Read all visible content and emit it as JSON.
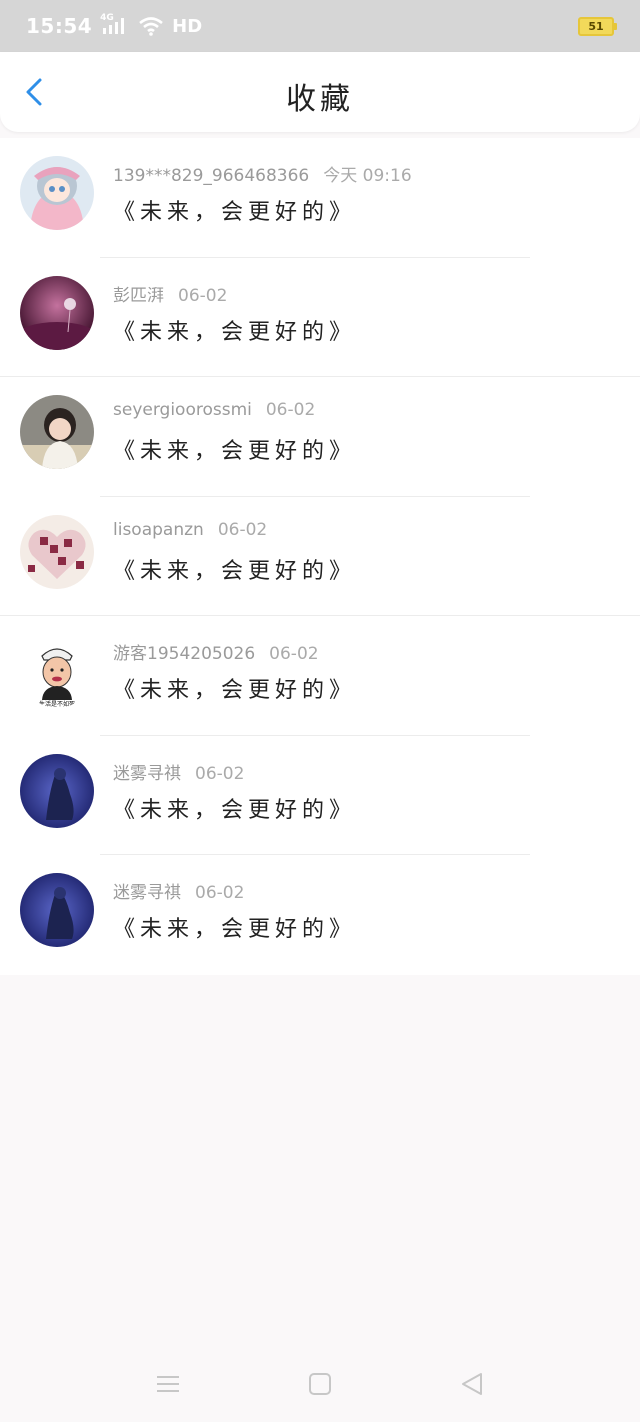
{
  "status_bar": {
    "time": "15:54",
    "network": "4G",
    "hd": "HD",
    "battery": "51"
  },
  "header": {
    "title": "收藏",
    "back_icon": "chevron-left-icon",
    "accent": "#2f8fe8"
  },
  "items": [
    {
      "user": "139***829_966468366",
      "date": "今天 09:16",
      "content": "《未来，会更好的》"
    },
    {
      "user": "彭匹湃",
      "date": "06-02",
      "content": "《未来，会更好的》"
    },
    {
      "user": "seyergioorossmi",
      "date": "06-02",
      "content": "《未来，会更好的》"
    },
    {
      "user": "lisoapanzn",
      "date": "06-02",
      "content": "《未来，会更好的》"
    },
    {
      "user": "游客1954205026",
      "date": "06-02",
      "content": "《未来，会更好的》"
    },
    {
      "user": "迷雾寻祺",
      "date": "06-02",
      "content": "《未来，会更好的》"
    },
    {
      "user": "迷雾寻祺",
      "date": "06-02",
      "content": "《未来，会更好的》"
    }
  ],
  "avatar_texts": {
    "item5": "生活是不如死"
  },
  "nav_bar": {
    "menu_icon": "menu-icon",
    "home_icon": "square-home-icon",
    "back_icon": "triangle-back-icon"
  }
}
